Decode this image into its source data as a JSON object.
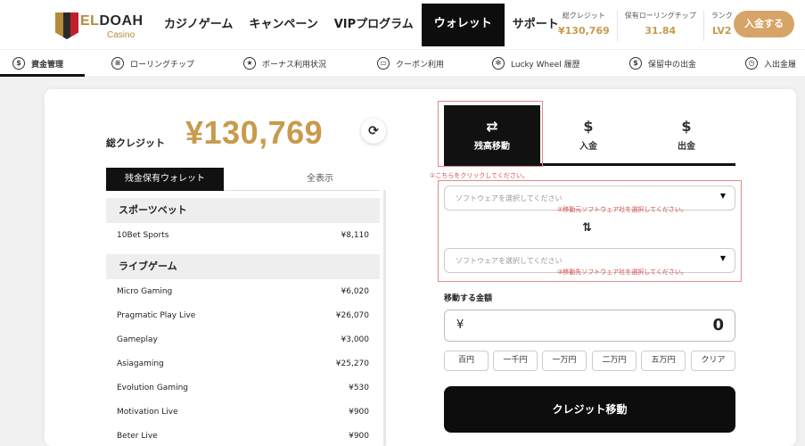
{
  "brand": {
    "name_prefix": "EL",
    "name_suffix": "DOAH",
    "subtitle": "Casino"
  },
  "nav": [
    {
      "label": "カジノゲーム"
    },
    {
      "label": "キャンペーン"
    },
    {
      "label": "VIPプログラム"
    },
    {
      "label": "ウォレット",
      "active": true
    },
    {
      "label": "サポート"
    }
  ],
  "stats": [
    {
      "label": "総クレジット",
      "value": "¥130,769"
    },
    {
      "label": "保有ローリングチップ",
      "value": "31.84"
    },
    {
      "label": "ランク",
      "value": "LV2"
    }
  ],
  "deposit_button": "入金する",
  "subnav": [
    {
      "label": "資金管理",
      "icon": "dollar-circle-icon",
      "glyph": "$",
      "active": true
    },
    {
      "label": "ローリングチップ",
      "icon": "chip-icon",
      "glyph": "≡"
    },
    {
      "label": "ボーナス利用状況",
      "icon": "star-badge-icon",
      "glyph": "★"
    },
    {
      "label": "クーポン利用",
      "icon": "coupon-icon",
      "glyph": "▭"
    },
    {
      "label": "Lucky Wheel 履歴",
      "icon": "wheel-icon",
      "glyph": "✻"
    },
    {
      "label": "保留中の出金",
      "icon": "pending-dollar-icon",
      "glyph": "$"
    },
    {
      "label": "入出金履",
      "icon": "clock-icon",
      "glyph": "◷"
    }
  ],
  "credit": {
    "label": "総クレジット",
    "amount": "¥130,769",
    "refresh_icon": "refresh-icon"
  },
  "wallet_tabs": [
    {
      "label": "残金保有ウォレット",
      "active": true
    },
    {
      "label": "全表示"
    }
  ],
  "wallet_sections": [
    {
      "title": "スポーツベット",
      "rows": [
        {
          "name": "10Bet Sports",
          "amount": "¥8,110"
        }
      ]
    },
    {
      "title": "ライブゲーム",
      "rows": [
        {
          "name": "Micro Gaming",
          "amount": "¥6,020"
        },
        {
          "name": "Pragmatic Play Live",
          "amount": "¥26,070"
        },
        {
          "name": "Gameplay",
          "amount": "¥3,000"
        },
        {
          "name": "Asiagaming",
          "amount": "¥25,270"
        },
        {
          "name": "Evolution Gaming",
          "amount": "¥530"
        },
        {
          "name": "Motivation Live",
          "amount": "¥900"
        },
        {
          "name": "Beter Live",
          "amount": "¥900"
        }
      ]
    }
  ],
  "transfer_tabs": [
    {
      "label": "残高移動",
      "icon": "swap-arrows-icon",
      "glyph": "⇄",
      "active": true
    },
    {
      "label": "入金",
      "icon": "deposit-dollar-icon",
      "glyph": "$"
    },
    {
      "label": "出金",
      "icon": "withdraw-dollar-icon",
      "glyph": "$"
    }
  ],
  "hints": {
    "click_here": "①こちらをクリックしてください。",
    "source_select": "②移動元ソフトウェア社を選択してください。",
    "target_select": "③移動先ソフトウェア社を選択してください。"
  },
  "selects": {
    "from_placeholder": "ソフトウェアを選択してください",
    "to_placeholder": "ソフトウェアを選択してください"
  },
  "amount": {
    "label": "移動する金額",
    "currency": "¥",
    "value": "0"
  },
  "quick_amounts": [
    "百円",
    "一千円",
    "一万円",
    "二万円",
    "五万円",
    "クリア"
  ],
  "submit_button": "クレジット移動",
  "colors": {
    "gold": "#c89a4c",
    "accent_button": "#d7a467",
    "dark": "#0d0d0d",
    "hint_red": "#d64a4a"
  }
}
